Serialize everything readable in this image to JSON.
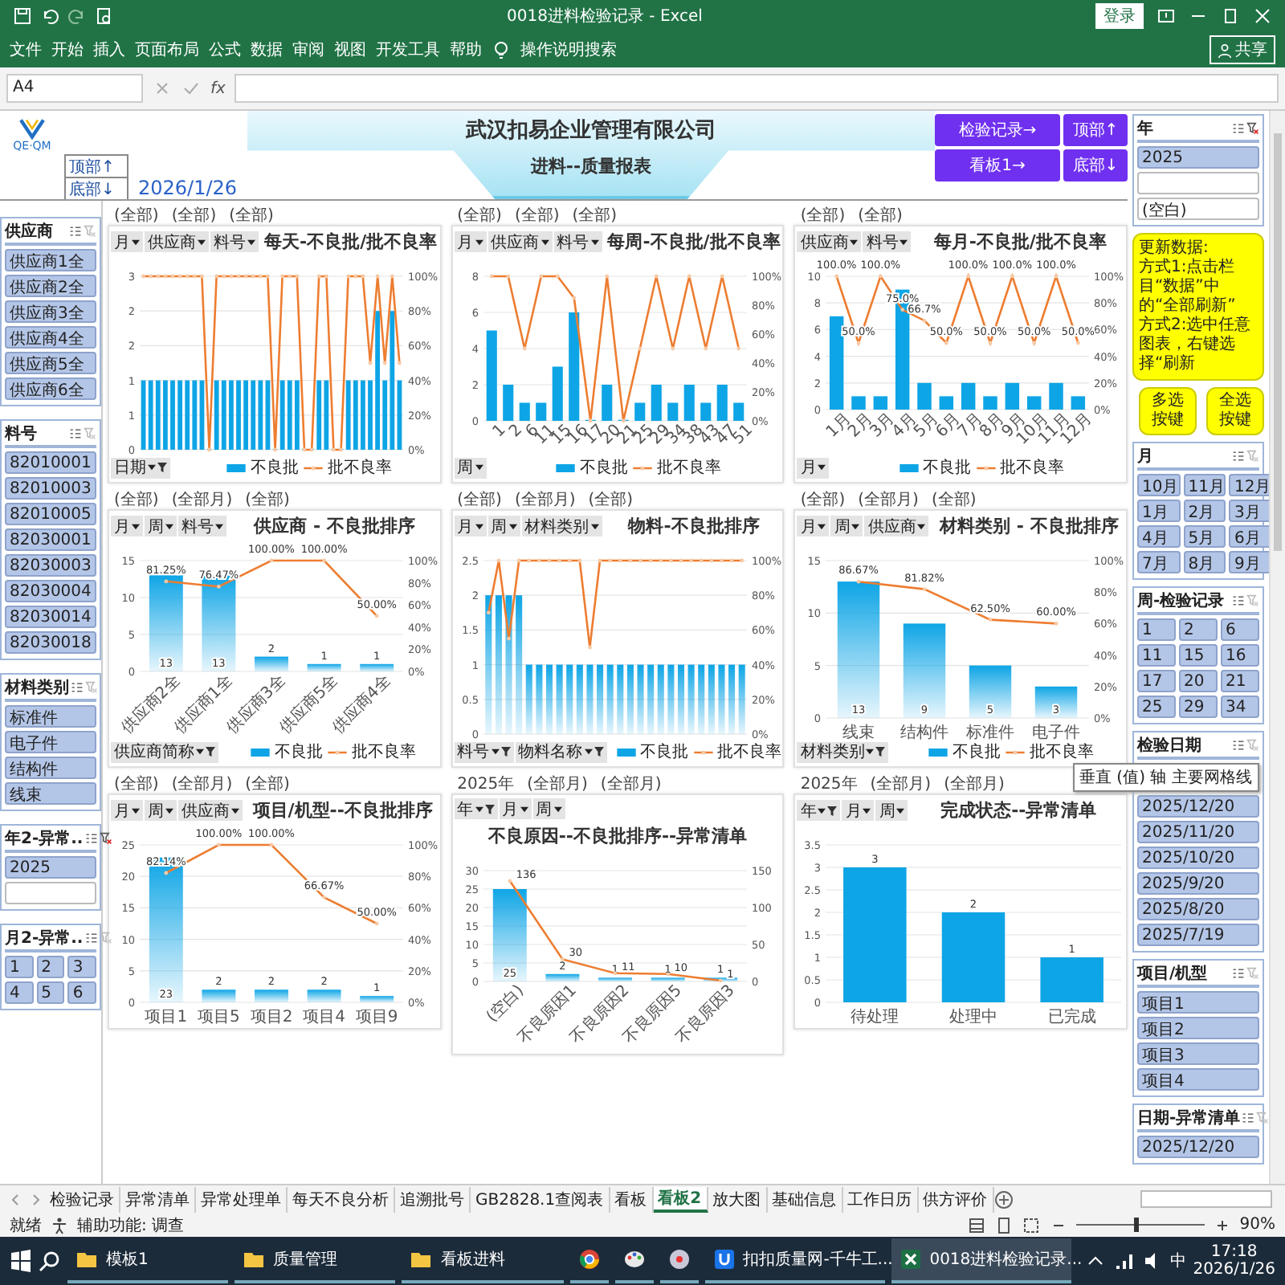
{
  "window": {
    "title": "0018进料检验记录 - Excel",
    "login": "登录",
    "share": "共享"
  },
  "ribbon_tabs": [
    "文件",
    "开始",
    "插入",
    "页面布局",
    "公式",
    "数据",
    "审阅",
    "视图",
    "开发工具",
    "帮助"
  ],
  "tell_me": "操作说明搜索",
  "name_box": "A4",
  "formula_label": "fx",
  "banner": {
    "logo": "QE·QM",
    "company": "武汉扣易企业管理有限公司",
    "subtitle": "进料--质量报表",
    "date": "2026/1/26",
    "nav_left": [
      "顶部↑",
      "底部↓"
    ],
    "nav_buttons": [
      "检验记录→",
      "顶部↑",
      "看板1→",
      "底部↓"
    ]
  },
  "left_slicers": [
    {
      "title": "供应商",
      "filtered": false,
      "items": [
        {
          "label": "供应商1全",
          "selected": true
        },
        {
          "label": "供应商2全",
          "selected": true
        },
        {
          "label": "供应商3全",
          "selected": true
        },
        {
          "label": "供应商4全",
          "selected": true
        },
        {
          "label": "供应商5全",
          "selected": true
        },
        {
          "label": "供应商6全",
          "selected": true
        }
      ]
    },
    {
      "title": "料号",
      "filtered": false,
      "items": [
        {
          "label": "82010001",
          "selected": true
        },
        {
          "label": "82010003",
          "selected": true
        },
        {
          "label": "82010005",
          "selected": true
        },
        {
          "label": "82030001",
          "selected": true
        },
        {
          "label": "82030003",
          "selected": true
        },
        {
          "label": "82030004",
          "selected": true
        },
        {
          "label": "82030014",
          "selected": true
        },
        {
          "label": "82030018",
          "selected": true
        }
      ]
    },
    {
      "title": "材料类别",
      "filtered": false,
      "items": [
        {
          "label": "标准件",
          "selected": true
        },
        {
          "label": "电子件",
          "selected": true
        },
        {
          "label": "结构件",
          "selected": true
        },
        {
          "label": "线束",
          "selected": true
        }
      ]
    },
    {
      "title": "年2-异常..",
      "filtered": true,
      "items": [
        {
          "label": "2025",
          "selected": true
        },
        {
          "selected": false
        }
      ]
    },
    {
      "title": "月2-异常..",
      "filtered": false,
      "items": [
        {
          "label": "1",
          "selected": true
        },
        {
          "label": "2",
          "selected": true
        },
        {
          "label": "3",
          "selected": true
        },
        {
          "label": "4",
          "selected": true
        },
        {
          "label": "5",
          "selected": true
        },
        {
          "label": "6",
          "selected": true
        }
      ]
    }
  ],
  "right_slicers": [
    {
      "title": "年",
      "filtered": true,
      "items": [
        {
          "label": "2025",
          "selected": true
        },
        {
          "selected": false
        },
        {
          "label": "(空白)",
          "selected": false
        }
      ]
    },
    {
      "title": "月",
      "filtered": false,
      "items": [
        {
          "label": "10月",
          "selected": true
        },
        {
          "label": "11月",
          "selected": true
        },
        {
          "label": "12月",
          "selected": true
        },
        {
          "label": "1月",
          "selected": true
        },
        {
          "label": "2月",
          "selected": true
        },
        {
          "label": "3月",
          "selected": true
        },
        {
          "label": "4月",
          "selected": true
        },
        {
          "label": "5月",
          "selected": true
        },
        {
          "label": "6月",
          "selected": true
        },
        {
          "label": "7月",
          "selected": true
        },
        {
          "label": "8月",
          "selected": true
        },
        {
          "label": "9月",
          "selected": true
        }
      ]
    },
    {
      "title": "周-检验记录",
      "filtered": false,
      "items": [
        {
          "label": "1",
          "selected": true
        },
        {
          "label": "2",
          "selected": true
        },
        {
          "label": "6",
          "selected": true
        },
        {
          "label": "11",
          "selected": true
        },
        {
          "label": "15",
          "selected": true
        },
        {
          "label": "16",
          "selected": true
        },
        {
          "label": "17",
          "selected": true
        },
        {
          "label": "20",
          "selected": true
        },
        {
          "label": "21",
          "selected": true
        },
        {
          "label": "25",
          "selected": true
        },
        {
          "label": "29",
          "selected": true
        },
        {
          "label": "34",
          "selected": true
        }
      ]
    },
    {
      "title": "检验日期",
      "filtered": false,
      "tooltip": "垂直 (值) 轴 主要网格线",
      "items": [
        {
          "label": "2025/12/20",
          "selected": true
        },
        {
          "label": "2025/11/20",
          "selected": true
        },
        {
          "label": "2025/10/20",
          "selected": true
        },
        {
          "label": "2025/9/20",
          "selected": true
        },
        {
          "label": "2025/8/20",
          "selected": true
        },
        {
          "label": "2025/7/19",
          "selected": true
        }
      ]
    },
    {
      "title": "项目/机型",
      "filtered": false,
      "items": [
        {
          "label": "项目1",
          "selected": true
        },
        {
          "label": "项目2",
          "selected": true
        },
        {
          "label": "项目3",
          "selected": true
        },
        {
          "label": "项目4",
          "selected": true
        }
      ]
    },
    {
      "title": "日期-异常清单",
      "filtered": false,
      "items": [
        {
          "label": "2025/12/20",
          "selected": true
        }
      ]
    }
  ],
  "note": {
    "heading": "更新数据:",
    "lines": [
      "方式1:点击栏目“数据”中的“全部刷新”",
      "方式2:选中任意图表，右键选择“刷新"
    ]
  },
  "callouts": [
    "多选按键",
    "全选按键"
  ],
  "charts": [
    {
      "filters": [
        "(全部)",
        "(全部)",
        "(全部)"
      ],
      "fields": [
        {
          "label": "月",
          "filtered": false
        },
        {
          "label": "供应商",
          "filtered": false
        },
        {
          "label": "料号",
          "filtered": false
        }
      ],
      "title": "每天-不良批/批不良率",
      "bottom_fields": [
        {
          "label": "日期",
          "filtered": true
        }
      ],
      "layers": [
        {
          "chart_data": {
            "type": "bar",
            "grid": true,
            "ylim": [
              0,
              2.5
            ],
            "yticks": [
              {
                "value": 0,
                "label": "0"
              },
              {
                "value": 0.5,
                "label": "1"
              },
              {
                "value": 1,
                "label": "1"
              },
              {
                "value": 1.5,
                "label": "2"
              },
              {
                "value": 2,
                "label": "2"
              },
              {
                "value": 2.5,
                "label": "3"
              }
            ],
            "series": [
              {
                "name": "不良批",
                "color": "#0ea5e6",
                "values": [
                  1,
                  1,
                  1,
                  1,
                  1,
                  1,
                  1,
                  1,
                  1,
                  0,
                  1,
                  1,
                  1,
                  1,
                  1,
                  1,
                  1,
                  1,
                  0,
                  1,
                  1,
                  1,
                  0,
                  0,
                  1,
                  1,
                  0,
                  0,
                  1,
                  1,
                  1,
                  1,
                  2,
                  1,
                  2,
                  1
                ]
              }
            ]
          }
        },
        {
          "chart_data": {
            "type": "line",
            "ylim": [
              0,
              1
            ],
            "yticks": [
              {
                "value": 0,
                "label": "0%"
              },
              {
                "value": 0.2,
                "label": "20%"
              },
              {
                "value": 0.4,
                "label": "40%"
              },
              {
                "value": 0.6,
                "label": "60%"
              },
              {
                "value": 0.8,
                "label": "80%"
              },
              {
                "value": 1,
                "label": "100%"
              }
            ],
            "series": [
              {
                "name": "批不良率",
                "color": "#ed7d31",
                "values": [
                  1,
                  1,
                  1,
                  1,
                  1,
                  1,
                  1,
                  1,
                  1,
                  0,
                  1,
                  1,
                  1,
                  1,
                  1,
                  1,
                  1,
                  1,
                  0,
                  1,
                  1,
                  1,
                  0,
                  0,
                  1,
                  1,
                  0,
                  0,
                  1,
                  1,
                  1,
                  0.5,
                  1,
                  0.5,
                  1,
                  0.5
                ]
              }
            ]
          }
        }
      ]
    },
    {
      "filters": [
        "(全部)",
        "(全部)",
        "(全部)"
      ],
      "fields": [
        {
          "label": "月",
          "filtered": false
        },
        {
          "label": "供应商",
          "filtered": false
        },
        {
          "label": "料号",
          "filtered": false
        }
      ],
      "title": "每周-不良批/批不良率",
      "bottom_fields": [
        {
          "label": "周",
          "filtered": false
        }
      ],
      "layers": [
        {
          "chart_data": {
            "type": "bar",
            "grid": true,
            "categories": [
              "1",
              "2",
              "6",
              "11",
              "15",
              "16",
              "17",
              "20",
              "21",
              "25",
              "29",
              "34",
              "38",
              "43",
              "47",
              "51"
            ],
            "ylim": [
              0,
              8
            ],
            "yticks": [
              0,
              2,
              4,
              6,
              8
            ],
            "series": [
              {
                "name": "不良批",
                "color": "#0ea5e6",
                "values": [
                  5,
                  2,
                  1,
                  1,
                  3,
                  6,
                  0,
                  2,
                  0,
                  1,
                  2,
                  1,
                  2,
                  1,
                  2,
                  1
                ]
              }
            ]
          }
        },
        {
          "chart_data": {
            "type": "line",
            "ylim": [
              0,
              1
            ],
            "yticks": [
              {
                "value": 0,
                "label": "0%"
              },
              {
                "value": 0.2,
                "label": "20%"
              },
              {
                "value": 0.4,
                "label": "40%"
              },
              {
                "value": 0.6,
                "label": "60%"
              },
              {
                "value": 0.8,
                "label": "80%"
              },
              {
                "value": 1,
                "label": "100%"
              }
            ],
            "series": [
              {
                "name": "批不良率",
                "color": "#ed7d31",
                "values": [
                  1,
                  1,
                  0.5,
                  1,
                  1,
                  0.85,
                  0,
                  1,
                  0,
                  0.5,
                  1,
                  0.5,
                  1,
                  0.5,
                  1,
                  0.5
                ]
              }
            ]
          }
        }
      ]
    },
    {
      "filters": [
        "(全部)",
        "(全部)"
      ],
      "fields": [
        {
          "label": "供应商",
          "filtered": false
        },
        {
          "label": "料号",
          "filtered": false
        }
      ],
      "title": "每月-不良批/批不良率",
      "bottom_fields": [
        {
          "label": "月",
          "filtered": false
        }
      ],
      "layers": [
        {
          "chart_data": {
            "type": "bar",
            "grid": true,
            "categories": [
              "1月",
              "2月",
              "3月",
              "4月",
              "5月",
              "6月",
              "7月",
              "8月",
              "9月",
              "10月",
              "11月",
              "12月"
            ],
            "ylim": [
              0,
              10
            ],
            "yticks": [
              0,
              2,
              4,
              6,
              8,
              10
            ],
            "series": [
              {
                "name": "不良批",
                "color": "#0ea5e6",
                "values": [
                  7,
                  1,
                  1,
                  9,
                  2,
                  1,
                  2,
                  1,
                  2,
                  1,
                  2,
                  1
                ]
              }
            ]
          }
        },
        {
          "chart_data": {
            "type": "line",
            "ylim": [
              0,
              1
            ],
            "yticks": [
              {
                "value": 0,
                "label": "0%"
              },
              {
                "value": 0.2,
                "label": "20%"
              },
              {
                "value": 0.4,
                "label": "40%"
              },
              {
                "value": 0.6,
                "label": "60%"
              },
              {
                "value": 0.8,
                "label": "80%"
              },
              {
                "value": 1,
                "label": "100%"
              }
            ],
            "series": [
              {
                "name": "批不良率",
                "color": "#ed7d31",
                "values": [
                  1,
                  0.5,
                  1,
                  0.75,
                  0.667,
                  0.5,
                  1,
                  0.5,
                  1,
                  0.5,
                  1,
                  0.5
                ],
                "value_labels": [
                  "100.0%",
                  "50.0%",
                  "100.0%",
                  "75.0%",
                  "66.7%",
                  "50.0%",
                  "100.0%",
                  "50.0%",
                  "100.0%",
                  "50.0%",
                  "100.0%",
                  "50.0%"
                ]
              }
            ]
          }
        }
      ]
    },
    {
      "filters": [
        "(全部)",
        "(全部月)",
        "(全部)"
      ],
      "fields": [
        {
          "label": "月",
          "filtered": false
        },
        {
          "label": "周",
          "filtered": false
        },
        {
          "label": "料号",
          "filtered": false
        }
      ],
      "title": "供应商 - 不良批排序",
      "bottom_fields": [
        {
          "label": "供应商简称",
          "filtered": true
        }
      ],
      "layers": [
        {
          "chart_data": {
            "type": "bar",
            "grid": true,
            "categories": [
              "供应商2全",
              "供应商1全",
              "供应商3全",
              "供应商5全",
              "供应商4全"
            ],
            "ylim": [
              0,
              15
            ],
            "yticks": [
              0,
              5,
              10,
              15
            ],
            "series": [
              {
                "name": "不良批",
                "color": "#0ea5e6",
                "values": [
                  13,
                  13,
                  2,
                  1,
                  1
                ],
                "value_labels": [
                  "13",
                  "13",
                  "2",
                  "1",
                  "1"
                ]
              }
            ]
          }
        },
        {
          "chart_data": {
            "type": "line",
            "ylim": [
              0,
              1
            ],
            "yticks": [
              {
                "value": 0,
                "label": "0%"
              },
              {
                "value": 0.2,
                "label": "20%"
              },
              {
                "value": 0.4,
                "label": "40%"
              },
              {
                "value": 0.6,
                "label": "60%"
              },
              {
                "value": 0.8,
                "label": "80%"
              },
              {
                "value": 1,
                "label": "100%"
              }
            ],
            "series": [
              {
                "name": "批不良率",
                "color": "#ed7d31",
                "values": [
                  0.8125,
                  0.7647,
                  1,
                  1,
                  0.5
                ],
                "value_labels": [
                  "81.25%",
                  "76.47%",
                  "100.00%",
                  "100.00%",
                  "50.00%"
                ]
              }
            ]
          }
        }
      ]
    },
    {
      "filters": [
        "(全部)",
        "(全部月)",
        "(全部)"
      ],
      "fields": [
        {
          "label": "月",
          "filtered": false
        },
        {
          "label": "周",
          "filtered": false
        },
        {
          "label": "材料类别",
          "filtered": false
        }
      ],
      "title": "物料-不良批排序",
      "bottom_fields": [
        {
          "label": "料号",
          "filtered": true
        },
        {
          "label": "物料名称",
          "filtered": true
        }
      ],
      "layers": [
        {
          "chart_data": {
            "type": "bar",
            "grid": true,
            "ylim": [
              0,
              2.5
            ],
            "yticks": [
              0,
              0.5,
              1,
              1.5,
              2,
              2.5
            ],
            "series": [
              {
                "name": "不良批",
                "color": "#0ea5e6",
                "values": [
                  2,
                  2,
                  2,
                  2,
                  1,
                  1,
                  1,
                  1,
                  1,
                  1,
                  1,
                  1,
                  1,
                  1,
                  1,
                  1,
                  1,
                  1,
                  1,
                  1,
                  1,
                  1,
                  1,
                  1,
                  1,
                  1
                ]
              }
            ]
          }
        },
        {
          "chart_data": {
            "type": "line",
            "ylim": [
              0,
              1
            ],
            "yticks": [
              {
                "value": 0,
                "label": "0%"
              },
              {
                "value": 0.2,
                "label": "20%"
              },
              {
                "value": 0.4,
                "label": "40%"
              },
              {
                "value": 0.6,
                "label": "60%"
              },
              {
                "value": 0.8,
                "label": "80%"
              },
              {
                "value": 1,
                "label": "100%"
              }
            ],
            "series": [
              {
                "name": "批不良率",
                "color": "#ed7d31",
                "values": [
                  0.7,
                  1,
                  0.55,
                  1,
                  1,
                  1,
                  1,
                  1,
                  1,
                  1,
                  0.5,
                  1,
                  1,
                  1,
                  1,
                  1,
                  1,
                  1,
                  1,
                  1,
                  1,
                  1,
                  1,
                  1,
                  1,
                  1
                ]
              }
            ]
          }
        }
      ]
    },
    {
      "filters": [
        "(全部)",
        "(全部月)",
        "(全部)"
      ],
      "fields": [
        {
          "label": "月",
          "filtered": false
        },
        {
          "label": "周",
          "filtered": false
        },
        {
          "label": "供应商",
          "filtered": false
        }
      ],
      "title": "材料类别 - 不良批排序",
      "bottom_fields": [
        {
          "label": "材料类别",
          "filtered": true
        }
      ],
      "layers": [
        {
          "chart_data": {
            "type": "bar",
            "grid": true,
            "categories": [
              "线束",
              "结构件",
              "标准件",
              "电子件"
            ],
            "ylim": [
              0,
              15
            ],
            "yticks": [
              0,
              5,
              10,
              15
            ],
            "series": [
              {
                "name": "不良批",
                "color": "#0ea5e6",
                "values": [
                  13,
                  9,
                  5,
                  3
                ],
                "value_labels": [
                  "13",
                  "9",
                  "5",
                  "3"
                ]
              }
            ]
          }
        },
        {
          "chart_data": {
            "type": "line",
            "ylim": [
              0,
              1
            ],
            "yticks": [
              {
                "value": 0,
                "label": "0%"
              },
              {
                "value": 0.2,
                "label": "20%"
              },
              {
                "value": 0.4,
                "label": "40%"
              },
              {
                "value": 0.6,
                "label": "60%"
              },
              {
                "value": 0.8,
                "label": "80%"
              },
              {
                "value": 1,
                "label": "100%"
              }
            ],
            "series": [
              {
                "name": "批不良率",
                "color": "#ed7d31",
                "values": [
                  0.8667,
                  0.8182,
                  0.625,
                  0.6
                ],
                "value_labels": [
                  "86.67%",
                  "81.82%",
                  "62.50%",
                  "60.00%"
                ]
              }
            ]
          }
        }
      ]
    },
    {
      "filters": [
        "(全部)",
        "(全部月)",
        "(全部)"
      ],
      "fields": [
        {
          "label": "月",
          "filtered": false
        },
        {
          "label": "周",
          "filtered": false
        },
        {
          "label": "供应商",
          "filtered": false
        }
      ],
      "title": "项目/机型--不良批排序",
      "layers": [
        {
          "chart_data": {
            "type": "bar",
            "grid": true,
            "categories": [
              "项目1",
              "项目5",
              "项目2",
              "项目4",
              "项目9"
            ],
            "ylim": [
              0,
              25
            ],
            "yticks": [
              0,
              5,
              10,
              15,
              20,
              25
            ],
            "series": [
              {
                "color": "#0ea5e6",
                "values": [
                  23,
                  2,
                  2,
                  2,
                  1
                ],
                "value_labels": [
                  "23",
                  "2",
                  "2",
                  "2",
                  "1"
                ]
              }
            ]
          }
        },
        {
          "chart_data": {
            "type": "line",
            "ylim": [
              0,
              1
            ],
            "yticks": [
              {
                "value": 0,
                "label": "0%"
              },
              {
                "value": 0.2,
                "label": "20%"
              },
              {
                "value": 0.4,
                "label": "40%"
              },
              {
                "value": 0.6,
                "label": "60%"
              },
              {
                "value": 0.8,
                "label": "80%"
              },
              {
                "value": 1,
                "label": "100%"
              }
            ],
            "series": [
              {
                "color": "#ed7d31",
                "values": [
                  0.8214,
                  1,
                  1,
                  0.6667,
                  0.5
                ],
                "value_labels": [
                  "82.14%",
                  "100.00%",
                  "100.00%",
                  "66.67%",
                  "50.00%"
                ]
              }
            ]
          }
        }
      ]
    },
    {
      "filters": [
        "2025年",
        "(全部月)",
        "(全部月)"
      ],
      "fields": [
        {
          "label": "年",
          "filtered": true
        },
        {
          "label": "月",
          "filtered": false
        },
        {
          "label": "周",
          "filtered": false
        }
      ],
      "title": "不良原因--不良批排序--异常清单",
      "layers": [
        {
          "chart_data": {
            "type": "bar",
            "grid": true,
            "categories": [
              "(空白)",
              "不良原因1",
              "不良原因2",
              "不良原因5",
              "不良原因3"
            ],
            "ylim": [
              0,
              30
            ],
            "yticks": [
              0,
              5,
              10,
              15,
              20,
              25,
              30
            ],
            "series": [
              {
                "color": "#0ea5e6",
                "values": [
                  25,
                  2,
                  1,
                  1,
                  1
                ],
                "value_labels": [
                  "25",
                  "2",
                  "1",
                  "1",
                  "1"
                ]
              }
            ]
          }
        },
        {
          "chart_data": {
            "type": "line",
            "ylim": [
              0,
              150
            ],
            "yticks": [
              0,
              50,
              100,
              150
            ],
            "series": [
              {
                "color": "#ed7d31",
                "values": [
                  136,
                  30,
                  11,
                  10,
                  1
                ],
                "value_labels": [
                  "136",
                  "30",
                  "11",
                  "10",
                  "1"
                ]
              }
            ]
          }
        }
      ]
    },
    {
      "filters": [
        "2025年",
        "(全部月)",
        "(全部月)"
      ],
      "fields": [
        {
          "label": "年",
          "filtered": true
        },
        {
          "label": "月",
          "filtered": false
        },
        {
          "label": "周",
          "filtered": false
        }
      ],
      "title": "完成状态--异常清单",
      "layers": [
        {
          "chart_data": {
            "type": "bar",
            "grid": true,
            "categories": [
              "待处理",
              "处理中",
              "已完成"
            ],
            "ylim": [
              0,
              3.5
            ],
            "yticks": [
              0,
              0.5,
              1,
              1.5,
              2,
              2.5,
              3,
              3.5
            ],
            "series": [
              {
                "color": "#0ea5e6",
                "values": [
                  3,
                  2,
                  1
                ],
                "value_labels": [
                  "3",
                  "2",
                  "1"
                ]
              }
            ]
          }
        }
      ]
    }
  ],
  "sheet_tabs": [
    {
      "label": "检验记录",
      "selected": false
    },
    {
      "label": "异常清单",
      "selected": false
    },
    {
      "label": "异常处理单",
      "selected": false
    },
    {
      "label": "每天不良分析",
      "selected": false
    },
    {
      "label": "追溯批号",
      "selected": false
    },
    {
      "label": "GB2828.1查阅表",
      "selected": false
    },
    {
      "label": "看板",
      "selected": false
    },
    {
      "label": "看板2",
      "selected": true
    },
    {
      "label": "放大图",
      "selected": false
    },
    {
      "label": "基础信息",
      "selected": false
    },
    {
      "label": "工作日历",
      "selected": false
    },
    {
      "label": "供方评价",
      "selected": false
    }
  ],
  "status_bar": {
    "ready": "就绪",
    "accessibility": "辅助功能: 调查",
    "zoom": {
      "label": "90%",
      "level": 0.47
    }
  },
  "taskbar": {
    "items": [
      {
        "kind": "folder",
        "label": "模板1",
        "selected": false
      },
      {
        "kind": "folder",
        "label": "质量管理",
        "selected": false
      },
      {
        "kind": "folder",
        "label": "看板进料",
        "selected": false
      },
      {
        "kind": "browser",
        "selected": false
      },
      {
        "kind": "paint",
        "selected": false
      },
      {
        "kind": "tool",
        "selected": false
      },
      {
        "kind": "app",
        "label": "扣扣质量网-千牛工...",
        "selected": false
      },
      {
        "kind": "excel",
        "label": "0018进料检验记录...",
        "selected": true
      }
    ],
    "ime": "中",
    "time": "17:18",
    "date": "2026/1/26"
  }
}
